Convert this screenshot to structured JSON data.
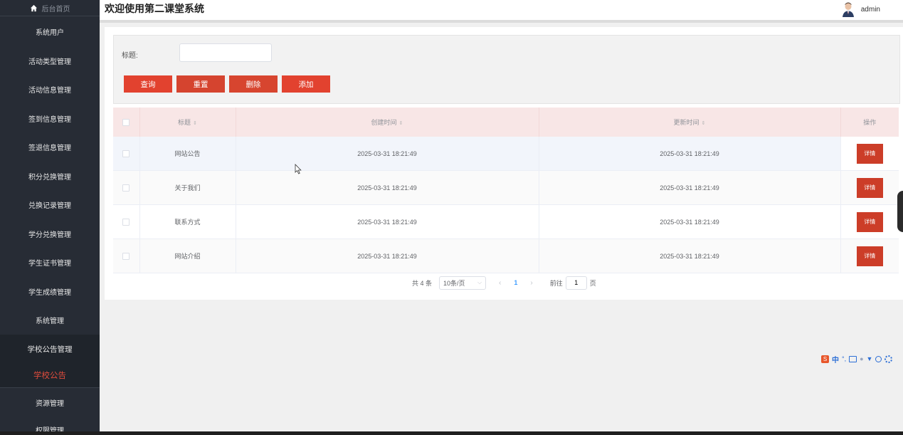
{
  "sidebar": {
    "home_label": "后台首页",
    "items": [
      {
        "label": "系统用户"
      },
      {
        "label": "活动类型管理"
      },
      {
        "label": "活动信息管理"
      },
      {
        "label": "签到信息管理"
      },
      {
        "label": "签退信息管理"
      },
      {
        "label": "积分兑换管理"
      },
      {
        "label": "兑换记录管理"
      },
      {
        "label": "学分兑换管理"
      },
      {
        "label": "学生证书管理"
      },
      {
        "label": "学生成绩管理"
      },
      {
        "label": "系统管理"
      }
    ],
    "active_parent": "学校公告管理",
    "active_child": "学校公告",
    "after_items": [
      {
        "label": "资源管理"
      },
      {
        "label": "权限管理"
      }
    ]
  },
  "header": {
    "title": "欢迎使用第二课堂系统",
    "username": "admin"
  },
  "search": {
    "title_label": "标题:",
    "title_value": "",
    "title_placeholder": ""
  },
  "buttons": {
    "query": "查询",
    "reset": "重置",
    "delete": "删除",
    "add": "添加"
  },
  "table": {
    "columns": {
      "title": "标题",
      "created": "创建时间",
      "updated": "更新时间",
      "action": "操作"
    },
    "rows": [
      {
        "title": "网站公告",
        "created": "2025-03-31 18:21:49",
        "updated": "2025-03-31 18:21:49",
        "action": "详情"
      },
      {
        "title": "关于我们",
        "created": "2025-03-31 18:21:49",
        "updated": "2025-03-31 18:21:49",
        "action": "详情"
      },
      {
        "title": "联系方式",
        "created": "2025-03-31 18:21:49",
        "updated": "2025-03-31 18:21:49",
        "action": "详情"
      },
      {
        "title": "网站介绍",
        "created": "2025-03-31 18:21:49",
        "updated": "2025-03-31 18:21:49",
        "action": "详情"
      }
    ]
  },
  "pagination": {
    "total": "共 4 条",
    "page_size": "10条/页",
    "current_page": "1",
    "goto_label": "前往",
    "goto_value": "1",
    "page_unit": "页"
  },
  "ime_toolbar": {
    "lang": "中",
    "punct": "°,"
  },
  "colors": {
    "sidebar_bg": "#272c35",
    "accent": "#e2422f",
    "table_header_bg": "#f8e6e6"
  }
}
